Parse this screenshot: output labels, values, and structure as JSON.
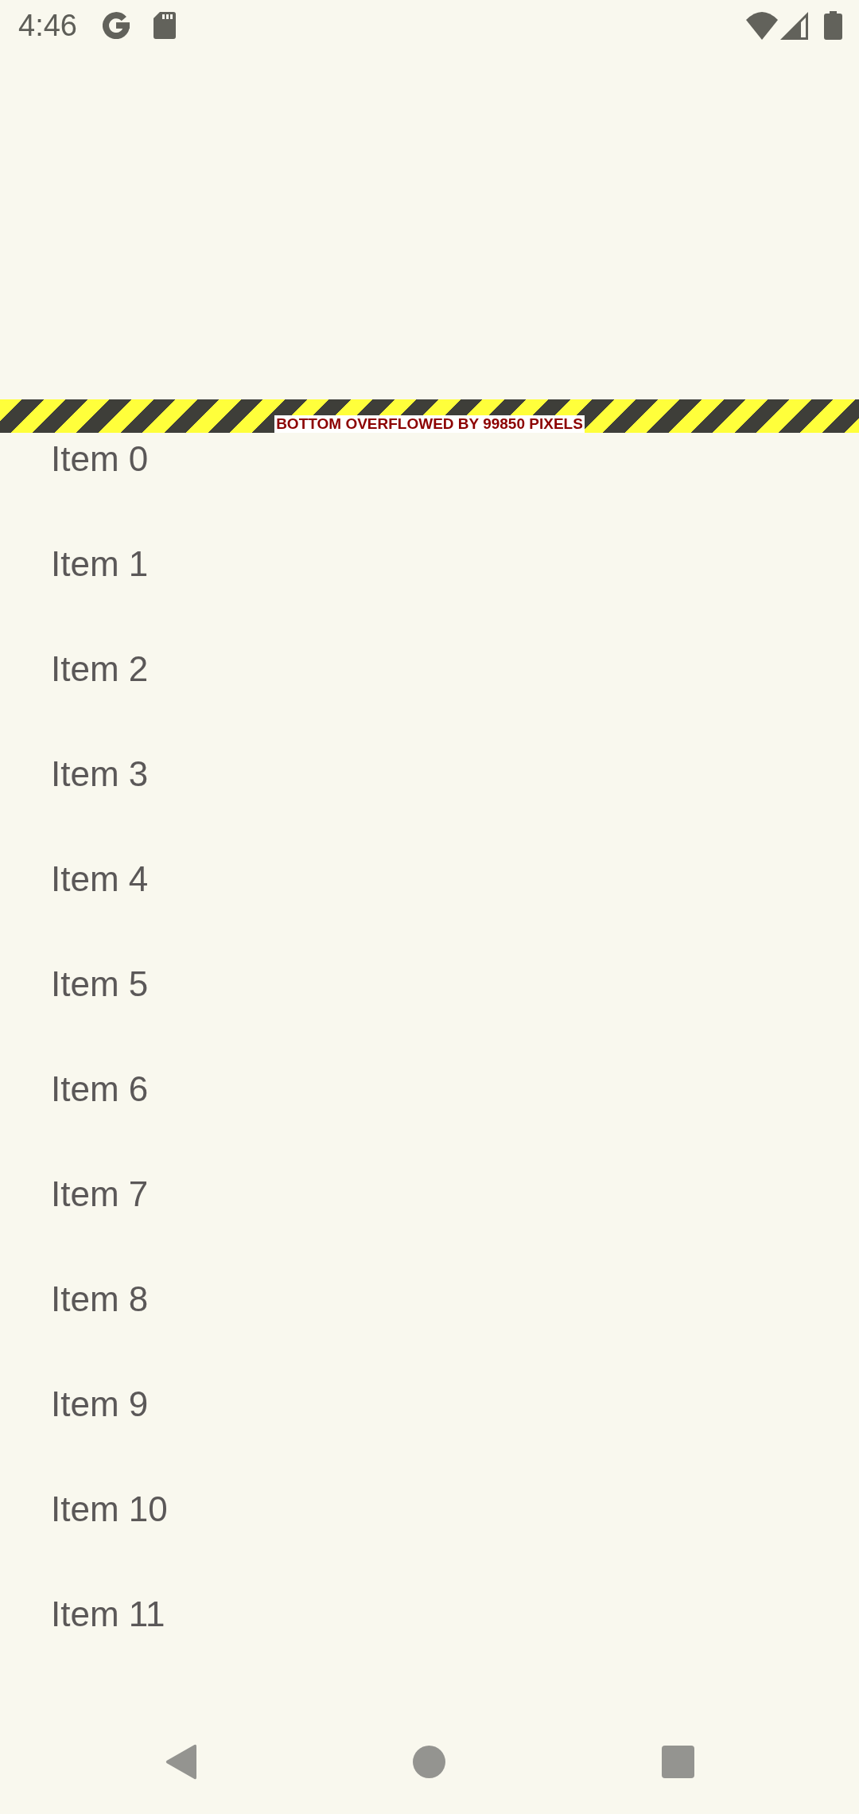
{
  "status_bar": {
    "time": "4:46"
  },
  "overflow_banner": {
    "text": "BOTTOM OVERFLOWED BY 99850 PIXELS"
  },
  "list": {
    "items": [
      "Item 0",
      "Item 1",
      "Item 2",
      "Item 3",
      "Item 4",
      "Item 5",
      "Item 6",
      "Item 7",
      "Item 8",
      "Item 9",
      "Item 10",
      "Item 11"
    ]
  }
}
